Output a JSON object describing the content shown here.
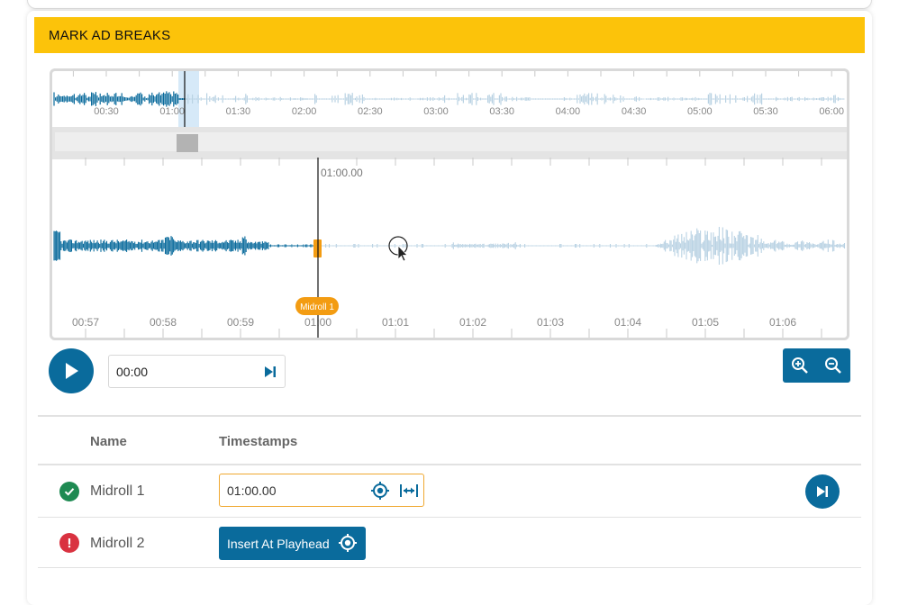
{
  "panel": {
    "title": "MARK AD BREAKS"
  },
  "overview": {
    "time_labels": [
      "00:30",
      "01:00",
      "01:30",
      "02:00",
      "02:30",
      "03:00",
      "03:30",
      "04:00",
      "04:30",
      "05:00",
      "05:30",
      "06:00"
    ],
    "played_color": "#0a6b9c",
    "unplayed_color": "#b9d2e3",
    "viewport_color": "#d6e9f8"
  },
  "detail": {
    "playhead_label": "01:00.00",
    "time_labels": [
      "00:57",
      "00:58",
      "00:59",
      "01:00",
      "01:01",
      "01:02",
      "01:03",
      "01:04",
      "01:05",
      "01:06"
    ],
    "marker_label": "Midroll 1",
    "marker_color": "#f39c12"
  },
  "player": {
    "time_value": "00:00"
  },
  "table": {
    "headers": {
      "name": "Name",
      "timestamps": "Timestamps"
    },
    "rows": [
      {
        "name": "Midroll 1",
        "status": "complete",
        "status_color": "#1e8a52",
        "timestamp": "01:00.00"
      },
      {
        "name": "Midroll 2",
        "status": "missing",
        "status_color": "#d93240",
        "action_label": "Insert At Playhead"
      }
    ]
  },
  "colors": {
    "accent": "#0a6b9c",
    "header": "#fcc30a",
    "warning_border": "#f0a830"
  }
}
